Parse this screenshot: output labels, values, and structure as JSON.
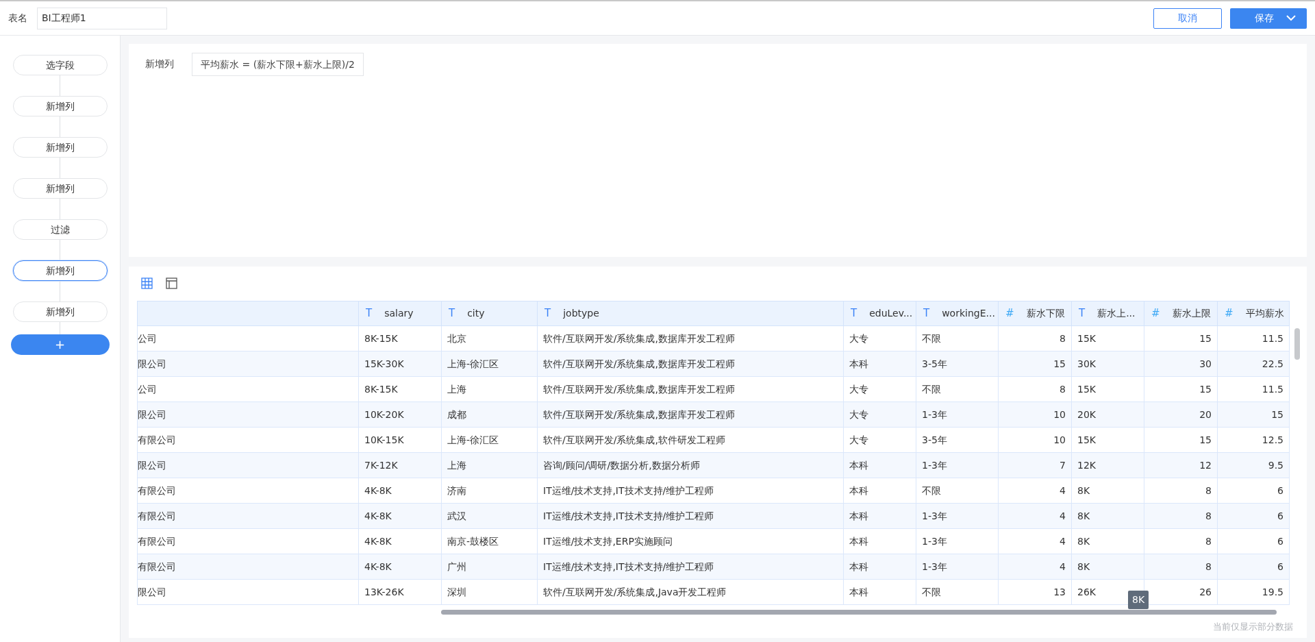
{
  "header": {
    "name_label": "表名",
    "name_value": "BI工程师1",
    "cancel": "取消",
    "save": "保存"
  },
  "steps": [
    {
      "label": "选字段",
      "selected": false
    },
    {
      "label": "新增列",
      "selected": false
    },
    {
      "label": "新增列",
      "selected": false
    },
    {
      "label": "新增列",
      "selected": false
    },
    {
      "label": "过滤",
      "selected": false
    },
    {
      "label": "新增列",
      "selected": true
    },
    {
      "label": "新增列",
      "selected": false
    }
  ],
  "add_step": "+",
  "formula": {
    "label": "新增列",
    "value": "平均薪水 = (薪水下限+薪水上限)/2"
  },
  "view_toggles": [
    {
      "kind": "table",
      "selected": true
    },
    {
      "kind": "panel",
      "selected": false
    }
  ],
  "table": {
    "columns": [
      {
        "kind": "text"
      },
      {
        "label": "salary",
        "kind": "text",
        "type_icon": "T"
      },
      {
        "label": "city",
        "kind": "text",
        "type_icon": "T"
      },
      {
        "label": "jobtype",
        "kind": "text",
        "type_icon": "T"
      },
      {
        "label": "eduLev...",
        "kind": "text",
        "type_icon": "T"
      },
      {
        "label": "workingE...",
        "kind": "text",
        "type_icon": "T"
      },
      {
        "label": "薪水下限",
        "kind": "number",
        "type_icon": "#"
      },
      {
        "label": "薪水上...",
        "kind": "text",
        "type_icon": "T"
      },
      {
        "label": "薪水上限",
        "kind": "number",
        "type_icon": "#"
      },
      {
        "label": "平均薪水",
        "kind": "number",
        "type_icon": "#"
      }
    ],
    "rows": [
      [
        "公司",
        "8K-15K",
        "北京",
        "软件/互联网开发/系统集成,数据库开发工程师",
        "大专",
        "不限",
        "8",
        "15K",
        "15",
        "11.5"
      ],
      [
        "限公司",
        "15K-30K",
        "上海-徐汇区",
        "软件/互联网开发/系统集成,数据库开发工程师",
        "本科",
        "3-5年",
        "15",
        "30K",
        "30",
        "22.5"
      ],
      [
        "公司",
        "8K-15K",
        "上海",
        "软件/互联网开发/系统集成,数据库开发工程师",
        "大专",
        "不限",
        "8",
        "15K",
        "15",
        "11.5"
      ],
      [
        "限公司",
        "10K-20K",
        "成都",
        "软件/互联网开发/系统集成,数据库开发工程师",
        "大专",
        "1-3年",
        "10",
        "20K",
        "20",
        "15"
      ],
      [
        "有限公司",
        "10K-15K",
        "上海-徐汇区",
        "软件/互联网开发/系统集成,软件研发工程师",
        "大专",
        "3-5年",
        "10",
        "15K",
        "15",
        "12.5"
      ],
      [
        "限公司",
        "7K-12K",
        "上海",
        "咨询/顾问/调研/数据分析,数据分析师",
        "本科",
        "1-3年",
        "7",
        "12K",
        "12",
        "9.5"
      ],
      [
        "有限公司",
        "4K-8K",
        "济南",
        "IT运维/技术支持,IT技术支持/维护工程师",
        "本科",
        "不限",
        "4",
        "8K",
        "8",
        "6"
      ],
      [
        "有限公司",
        "4K-8K",
        "武汉",
        "IT运维/技术支持,IT技术支持/维护工程师",
        "本科",
        "1-3年",
        "4",
        "8K",
        "8",
        "6"
      ],
      [
        "有限公司",
        "4K-8K",
        "南京-鼓楼区",
        "IT运维/技术支持,ERP实施顾问",
        "本科",
        "1-3年",
        "4",
        "8K",
        "8",
        "6"
      ],
      [
        "有限公司",
        "4K-8K",
        "广州",
        "IT运维/技术支持,IT技术支持/维护工程师",
        "本科",
        "1-3年",
        "4",
        "8K",
        "8",
        "6"
      ],
      [
        "限公司",
        "13K-26K",
        "深圳",
        "软件/互联网开发/系统集成,Java开发工程师",
        "本科",
        "不限",
        "13",
        "26K",
        "26",
        "19.5"
      ]
    ]
  },
  "tooltip": "8K",
  "footer_note": "当前仅显示部分数据"
}
